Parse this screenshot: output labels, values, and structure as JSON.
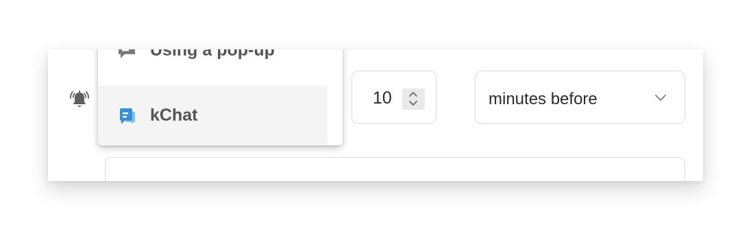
{
  "reminder": {
    "icon": "alarm-bell-icon",
    "amount": "10",
    "unit": "minutes before"
  },
  "method_dropdown": {
    "options": [
      {
        "label": "Using a pop-up",
        "icon": "popup-message-icon",
        "highlighted": false
      },
      {
        "label": "kChat",
        "icon": "kchat-icon",
        "highlighted": true
      }
    ]
  },
  "colors": {
    "kchat_icon": "#3a8fd4",
    "popup_icon": "#7a7a7a",
    "highlight_bg": "#f4f4f4"
  }
}
